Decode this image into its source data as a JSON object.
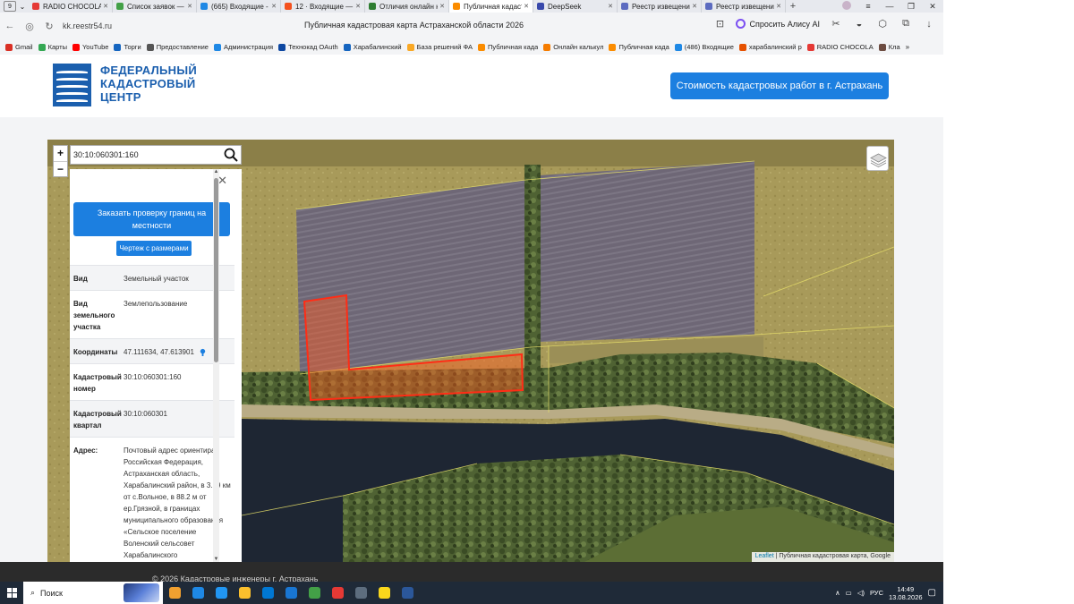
{
  "browser": {
    "tab_count": "9",
    "tabs": [
      {
        "title": "RADIO CHOCOLATE",
        "color": "#e53935",
        "close": "✕"
      },
      {
        "title": "Список заявок — Те",
        "color": "#43a047",
        "close": "✕"
      },
      {
        "title": "(665) Входящие - По",
        "color": "#1e88e5",
        "close": "✕"
      },
      {
        "title": "12 · Входящие — Ян",
        "color": "#f4511e",
        "close": "✕"
      },
      {
        "title": "Отличия онлайн на",
        "color": "#2e7d32",
        "close": "✕"
      },
      {
        "title": "Публичная кадаст",
        "color": "#fb8c00",
        "close": "✕",
        "active": true
      },
      {
        "title": "DeepSeek",
        "color": "#3949ab",
        "close": "✕"
      },
      {
        "title": "Реестр извещений",
        "color": "#5c6bc0",
        "close": "✕"
      },
      {
        "title": "Реестр извещений",
        "color": "#5c6bc0",
        "close": "✕"
      }
    ],
    "new_tab": "+",
    "url": "kk.reestr54.ru",
    "page_title": "Публичная кадастровая карта Астраханской области 2026",
    "alice_label": "Спросить Алису AI",
    "bookmarks": [
      {
        "label": "Gmail",
        "color": "#d93025"
      },
      {
        "label": "Карты",
        "color": "#34a853"
      },
      {
        "label": "YouTube",
        "color": "#ff0000"
      },
      {
        "label": "Торги",
        "color": "#1565c0"
      },
      {
        "label": "Предоставление",
        "color": "#555555"
      },
      {
        "label": "Администрация",
        "color": "#1e88e5"
      },
      {
        "label": "Технокад OAuth",
        "color": "#0d47a1"
      },
      {
        "label": "Харабалинский",
        "color": "#1565c0"
      },
      {
        "label": "База решений ФА",
        "color": "#f9a825"
      },
      {
        "label": "Публичная када",
        "color": "#fb8c00"
      },
      {
        "label": "Онлайн калькул",
        "color": "#f57c00"
      },
      {
        "label": "Публичная када",
        "color": "#fb8c00"
      },
      {
        "label": "(486) Входящие",
        "color": "#1e88e5"
      },
      {
        "label": "харабалинский р",
        "color": "#e65100"
      },
      {
        "label": "RADIO CHOCOLA",
        "color": "#e53935"
      },
      {
        "label": "Кла",
        "color": "#6d4c41"
      }
    ],
    "bookmarks_more": "»"
  },
  "site": {
    "logo_lines": [
      "ФЕДЕРАЛЬНЫЙ",
      "КАДАСТРОВЫЙ",
      "ЦЕНТР"
    ],
    "cta_label": "Стоимость кадастровых работ в г. Астрахань",
    "brand_color": "#1b5fae",
    "accent_color": "#1c7fe0"
  },
  "map": {
    "search_value": "30:10:060301:160",
    "zoom_in": "+",
    "zoom_out": "−",
    "attribution_link": "Leaflet",
    "attribution_text": "| Публичная кадастровая карта, Google",
    "parcel_color": "#ff2d16"
  },
  "panel": {
    "close": "✕",
    "order_button": "Заказать проверку границ на местности",
    "drawing_button": "Чертеж с размерами",
    "rows": [
      {
        "key": "Вид",
        "value": "Земельный участок"
      },
      {
        "key": "Вид земельного участка",
        "value": "Землепользование"
      },
      {
        "key": "Координаты",
        "value": "47.111634, 47.613901"
      },
      {
        "key": "Кадастровый номер",
        "value": "30:10:060301:160"
      },
      {
        "key": "Кадастровый квартал",
        "value": "30:10:060301"
      },
      {
        "key": "Адрес:",
        "value": "Почтовый адрес ориентира: Российская Федерация, Астраханская область, Харабалинский район, в 3.59 км от с.Вольное, в 88.2 м от ер.Грязной, в границах муниципального образования «Сельское поселение Воленский сельсовет Харабалинского муниципального района"
      }
    ]
  },
  "footer": {
    "text": "© 2026 Кадастровые инженеры г. Астрахань"
  },
  "taskbar": {
    "search_label": "Поиск",
    "apps": [
      "#f0a030",
      "#1e88e5",
      "#2196f3",
      "#fbc02d",
      "#0078d4",
      "#1976d2",
      "#43a047",
      "#e53935",
      "#5d6d7e",
      "#f9d71c",
      "#2b579a"
    ],
    "language": "РУС",
    "time": "14:49",
    "date": "13.08.2026"
  }
}
